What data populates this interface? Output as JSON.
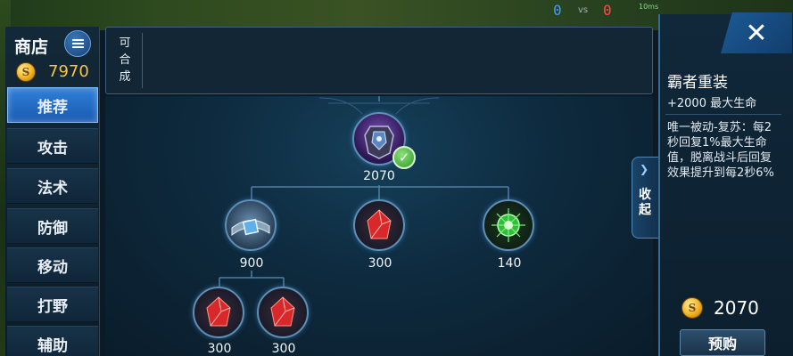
{
  "hud": {
    "score_blue": "0",
    "vs": "vs",
    "score_red": "0",
    "network": "10ms"
  },
  "sidebar": {
    "title": "商店",
    "gold": "7970",
    "categories": [
      "推荐",
      "攻击",
      "法术",
      "防御",
      "移动",
      "打野",
      "辅助"
    ],
    "active_index": 0
  },
  "synth": {
    "label": "可合成"
  },
  "tree": {
    "root": {
      "price": "2070",
      "owned": true
    },
    "children": [
      {
        "price": "900"
      },
      {
        "price": "300"
      },
      {
        "price": "140"
      }
    ],
    "grandchildren": [
      {
        "price": "300"
      },
      {
        "price": "300"
      }
    ]
  },
  "detail": {
    "name": "霸者重装",
    "stat": "+2000 最大生命",
    "description": "唯一被动-复苏：每2秒回复1%最大生命值，脱离战斗后回复效果提升到每2秒6%",
    "collapse_label": "收起",
    "price": "2070",
    "preview_label": "预购"
  },
  "colors": {
    "accent": "#2f7fd8",
    "gold": "#f5c64a",
    "panel": "#122636"
  }
}
